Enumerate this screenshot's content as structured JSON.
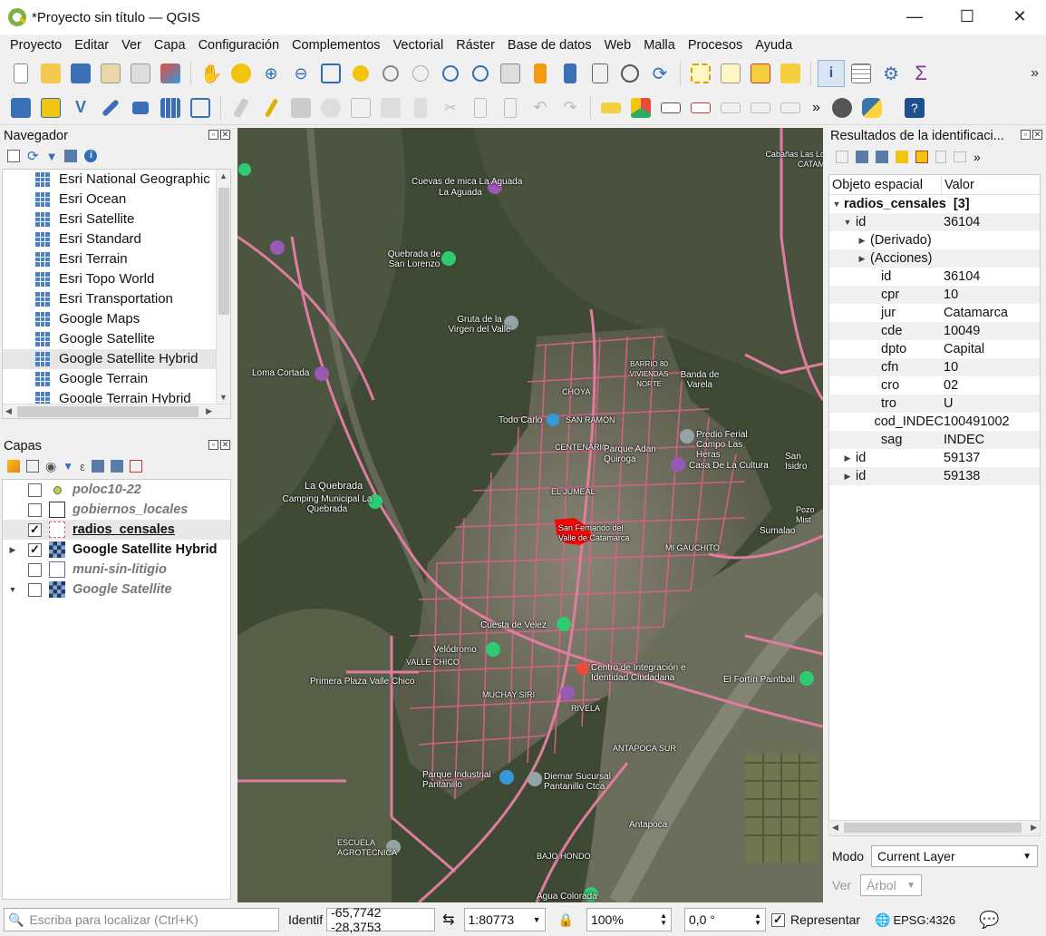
{
  "window": {
    "title": "*Proyecto sin título — QGIS",
    "minimize": "—",
    "maximize": "☐",
    "close": "✕"
  },
  "menu": [
    "Proyecto",
    "Editar",
    "Ver",
    "Capa",
    "Configuración",
    "Complementos",
    "Vectorial",
    "Ráster",
    "Base de datos",
    "Web",
    "Malla",
    "Procesos",
    "Ayuda"
  ],
  "toolbar_more": "»",
  "navigator": {
    "title": "Navegador",
    "items": [
      "Esri National Geographic",
      "Esri Ocean",
      "Esri Satellite",
      "Esri Standard",
      "Esri Terrain",
      "Esri Topo World",
      "Esri Transportation",
      "Google Maps",
      "Google Satellite",
      "Google Satellite Hybrid",
      "Google Terrain",
      "Google Terrain Hybrid"
    ],
    "selected": "Google Satellite Hybrid"
  },
  "layers": {
    "title": "Capas",
    "items": [
      {
        "name": "poloc10-22",
        "checked": false,
        "style": "italic"
      },
      {
        "name": "gobiernos_locales",
        "checked": false,
        "style": "italic"
      },
      {
        "name": "radios_censales",
        "checked": true,
        "style": "bold-underline"
      },
      {
        "name": "Google Satellite Hybrid",
        "checked": true,
        "style": "bold"
      },
      {
        "name": "muni-sin-litigio",
        "checked": false,
        "style": "italic"
      },
      {
        "name": "Google Satellite",
        "checked": false,
        "style": "italic"
      }
    ]
  },
  "map": {
    "labels": [
      "Cuevas de mica La Aguada",
      "Quebrada de San Lorenzo",
      "Gruta de la Virgen del Valle",
      "Loma Cortada",
      "BARRIO 80 VIVIENDAS NORTE",
      "Banda de Varela",
      "CHOYA",
      "Todo Carlo",
      "SAN RAMÓN",
      "Predio Ferial Campo Las Heras",
      "CENTENARIO",
      "Parque Adan Quiroga",
      "Casa De La Cultura",
      "San Isidro",
      "La Quebrada",
      "Camping Municipal La Quebrada",
      "EL JUMEAL",
      "San Fernando del Valle de Catamarca",
      "MI GAUCHITO",
      "Sumalao",
      "Cuesta de Velez",
      "Velódromo",
      "VALLE CHICO",
      "Centro de Integración e Identidad Ciudadana",
      "El Fortín Paintball",
      "Primera Plaza Valle Chico",
      "MUCHAY SIRI",
      "RIVELA",
      "ANTAPOCA SUR",
      "Parque Industrial Pantanillo",
      "Diemar Sucursal Pantanillo Ctca",
      "Antapoca",
      "ESCUELA AGROTECNICA",
      "BAJO HONDO",
      "Agua Colorada",
      "Cabañas Las Lo CATAM",
      "La Aguada",
      "Pozo Mist"
    ]
  },
  "identify": {
    "title": "Resultados de la identificaci...",
    "col_feature": "Objeto espacial",
    "col_value": "Valor",
    "layer": "radios_censales",
    "count": "[3]",
    "rows": [
      {
        "k": "id",
        "v": "36104",
        "indent": 1,
        "tri": "▼",
        "alt": true
      },
      {
        "k": "(Derivado)",
        "v": "",
        "indent": 2,
        "tri": "▶",
        "alt": false
      },
      {
        "k": "(Acciones)",
        "v": "",
        "indent": 2,
        "tri": "▶",
        "alt": true
      },
      {
        "k": "id",
        "v": "36104",
        "indent": 3,
        "tri": "",
        "alt": false
      },
      {
        "k": "cpr",
        "v": "10",
        "indent": 3,
        "tri": "",
        "alt": true
      },
      {
        "k": "jur",
        "v": "Catamarca",
        "indent": 3,
        "tri": "",
        "alt": false
      },
      {
        "k": "cde",
        "v": "10049",
        "indent": 3,
        "tri": "",
        "alt": true
      },
      {
        "k": "dpto",
        "v": "Capital",
        "indent": 3,
        "tri": "",
        "alt": false
      },
      {
        "k": "cfn",
        "v": "10",
        "indent": 3,
        "tri": "",
        "alt": true
      },
      {
        "k": "cro",
        "v": "02",
        "indent": 3,
        "tri": "",
        "alt": false
      },
      {
        "k": "tro",
        "v": "U",
        "indent": 3,
        "tri": "",
        "alt": true
      },
      {
        "k": "cod_INDEC",
        "v": "100491002",
        "indent": 3,
        "tri": "",
        "alt": false
      },
      {
        "k": "sag",
        "v": "INDEC",
        "indent": 3,
        "tri": "",
        "alt": true
      },
      {
        "k": "id",
        "v": "59137",
        "indent": 1,
        "tri": "▶",
        "alt": false
      },
      {
        "k": "id",
        "v": "59138",
        "indent": 1,
        "tri": "▶",
        "alt": true
      }
    ],
    "modo_label": "Modo",
    "modo_value": "Current Layer",
    "ver_label": "Ver",
    "ver_value": "Árbol"
  },
  "status": {
    "locator_placeholder": "Escriba para localizar (Ctrl+K)",
    "coord_label": "Identif",
    "coordinate": "-65,7742 -28,3753",
    "scale": "1:80773",
    "magnifier": "100%",
    "rotation": "0,0 °",
    "render_label": "Representar",
    "crs": "EPSG:4326"
  },
  "colors": {
    "accent_roads": "#d9628a",
    "selection": "#ff0000",
    "poi_purple": "#9b59b6",
    "poi_green": "#2ecc71",
    "poi_blue": "#3498db"
  }
}
